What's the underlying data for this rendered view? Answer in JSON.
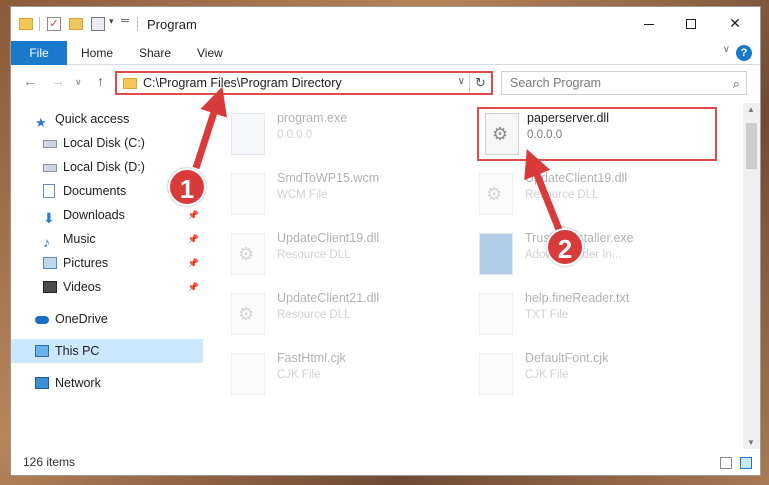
{
  "window": {
    "title": "Program",
    "qa_check": "✓",
    "qa_arrow": "▾",
    "qa_pin": "═"
  },
  "ribbon": {
    "tabs": [
      "File",
      "Home",
      "Share",
      "View"
    ],
    "expand": "∨",
    "help": "?"
  },
  "nav": {
    "back": "←",
    "forward": "→",
    "recent": "∨",
    "up": "↑",
    "address": "C:\\Program Files\\Program Directory",
    "address_drop": "∨",
    "refresh": "↻",
    "search_placeholder": "Search Program",
    "search_glyph": "⌕"
  },
  "sidebar": {
    "items": [
      {
        "label": "Quick access",
        "icon": "star-icon"
      },
      {
        "label": "Local Disk (C:)",
        "icon": "drive-icon"
      },
      {
        "label": "Local Disk (D:)",
        "icon": "drive-icon"
      },
      {
        "label": "Documents",
        "icon": "documents-icon"
      },
      {
        "label": "Downloads",
        "icon": "download-icon",
        "pin": "📌"
      },
      {
        "label": "Music",
        "icon": "music-icon",
        "pin": "📌"
      },
      {
        "label": "Pictures",
        "icon": "pictures-icon",
        "pin": "📌"
      },
      {
        "label": "Videos",
        "icon": "videos-icon",
        "pin": "📌"
      },
      {
        "label": "OneDrive",
        "icon": "cloud-icon"
      },
      {
        "label": "This PC",
        "icon": "computer-icon"
      },
      {
        "label": "Network",
        "icon": "network-icon"
      }
    ]
  },
  "files": [
    {
      "name": "program.exe",
      "sub": "0.0.0.0",
      "icon": "exe-icon"
    },
    {
      "name": "paperserver.dll",
      "sub": "0.0.0.0",
      "icon": "dll-icon"
    },
    {
      "name": "SmdToWP15.wcm",
      "sub": "WCM File",
      "icon": "file-icon"
    },
    {
      "name": "UpdateClient19.dll",
      "sub": "Resource DLL",
      "icon": "dll-icon"
    },
    {
      "name": "UpdateClient19.dll",
      "sub": "Resource DLL",
      "icon": "dll-icon"
    },
    {
      "name": "TrustedInstaller.exe",
      "sub": "Adobe Reader In...",
      "icon": "exe-icon"
    },
    {
      "name": "UpdateClient21.dll",
      "sub": "Resource DLL",
      "icon": "dll-icon"
    },
    {
      "name": "help.fineReader.txt",
      "sub": "TXT File",
      "icon": "file-icon"
    },
    {
      "name": "FastHtml.cjk",
      "sub": "CJK File",
      "icon": "file-icon"
    },
    {
      "name": "DefaultFont.cjk",
      "sub": "CJK File",
      "icon": "file-icon"
    }
  ],
  "status": {
    "count": "126 items"
  },
  "annotations": {
    "step1": "1",
    "step2": "2"
  },
  "colors": {
    "accent": "#1979ca",
    "highlight": "#e04b4b",
    "selected": "#cce8ff"
  }
}
